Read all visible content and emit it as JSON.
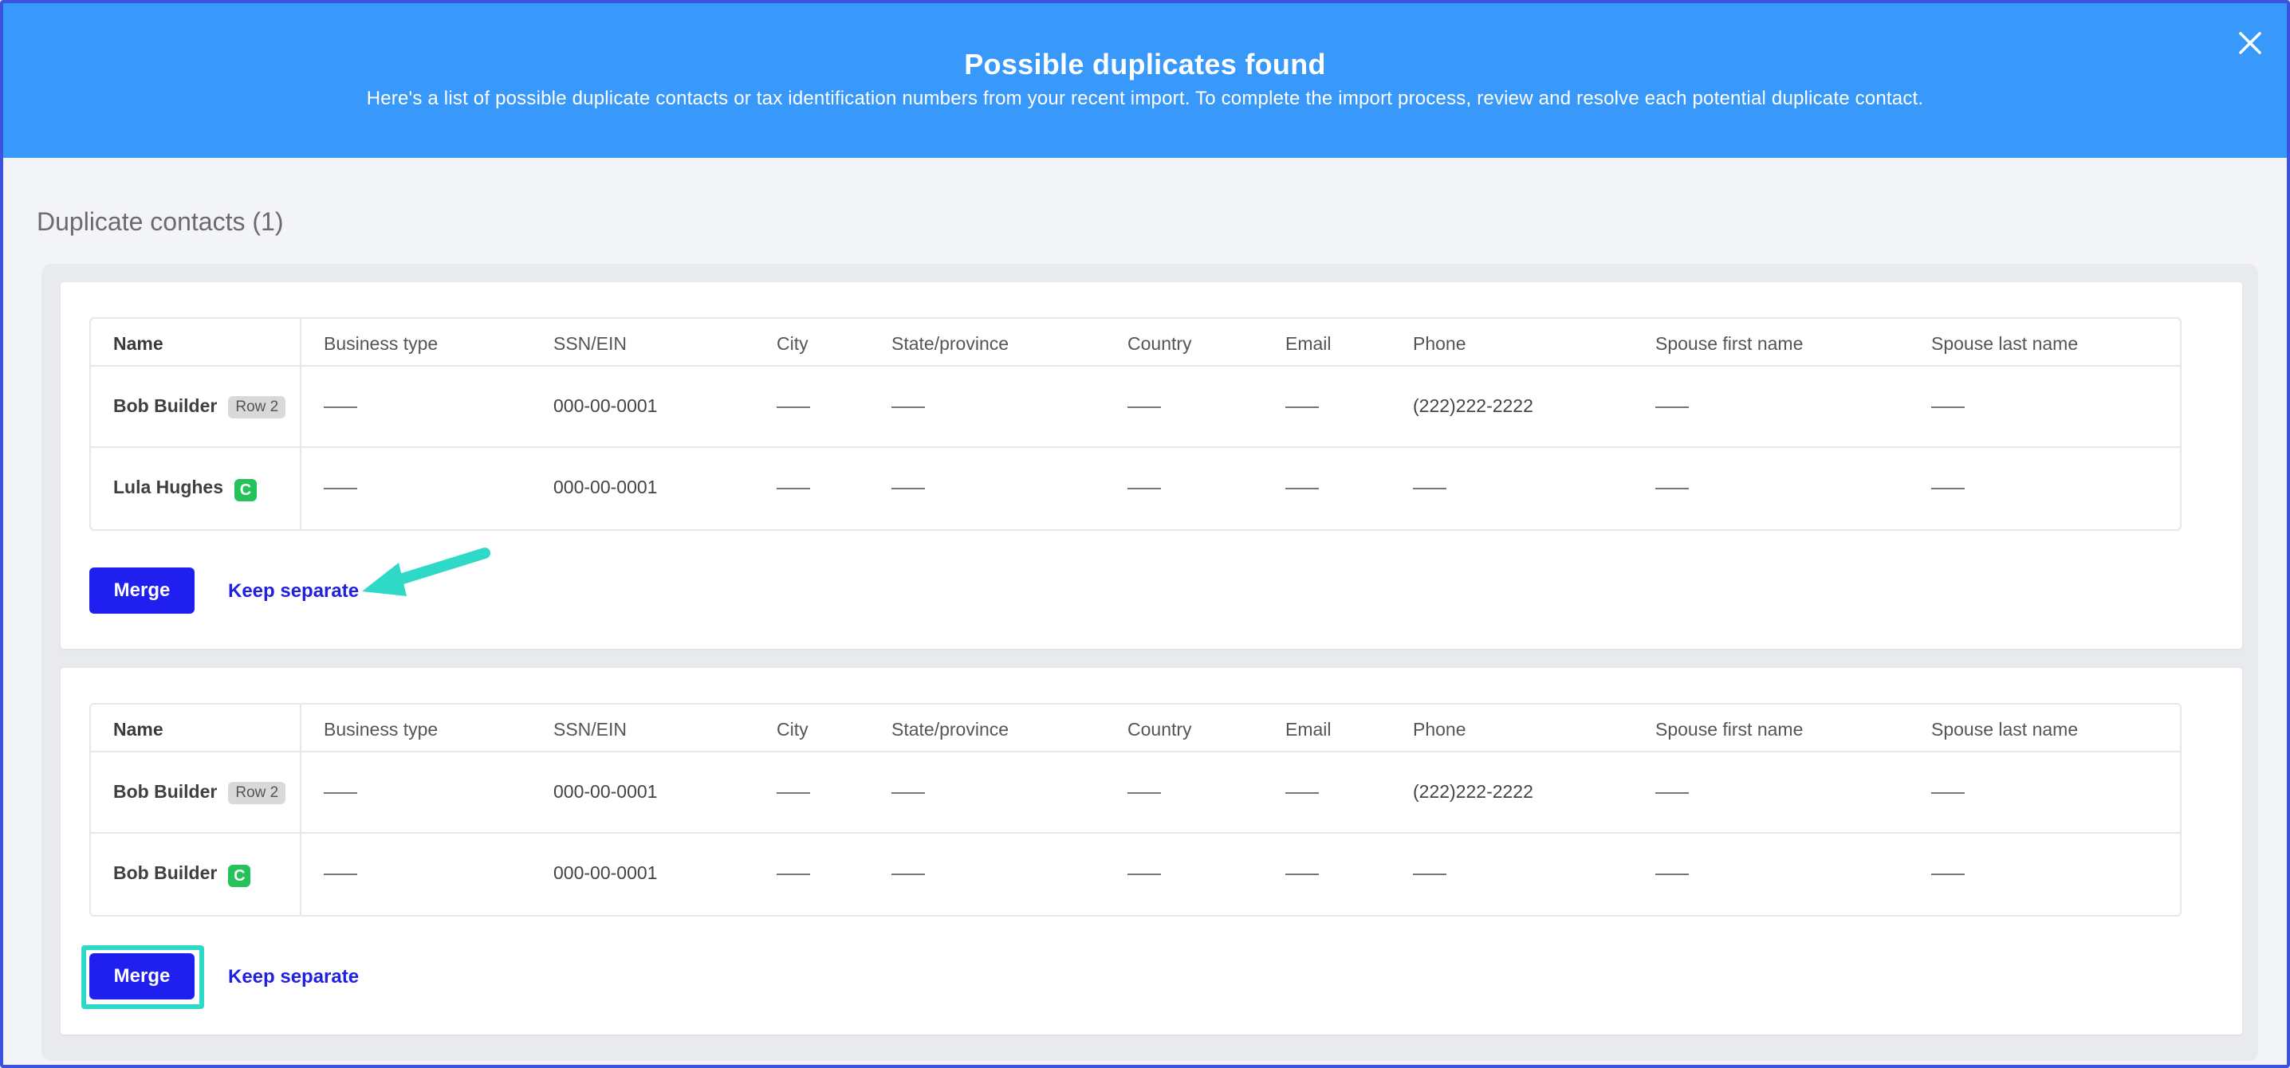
{
  "banner": {
    "title": "Possible duplicates found",
    "subtitle": "Here's a list of possible duplicate contacts or tax identification numbers from your recent import. To complete the import process, review and resolve each potential duplicate contact.",
    "close_icon": "close-icon"
  },
  "section": {
    "title": "Duplicate contacts (1)"
  },
  "columns": [
    "Name",
    "Business type",
    "SSN/EIN",
    "City",
    "State/province",
    "Country",
    "Email",
    "Phone",
    "Spouse first name",
    "Spouse last name"
  ],
  "groups": [
    {
      "rows": [
        {
          "name": "Bob Builder",
          "badge": "Row 2",
          "badge_type": "row",
          "ssn": "000-00-0001",
          "phone": "(222)222-2222"
        },
        {
          "name": "Lula Hughes",
          "badge": "C",
          "badge_type": "contact",
          "ssn": "000-00-0001",
          "phone": ""
        }
      ],
      "merge_label": "Merge",
      "keep_label": "Keep separate"
    },
    {
      "rows": [
        {
          "name": "Bob Builder",
          "badge": "Row 2",
          "badge_type": "row",
          "ssn": "000-00-0001",
          "phone": "(222)222-2222"
        },
        {
          "name": "Bob Builder",
          "badge": "C",
          "badge_type": "contact",
          "ssn": "000-00-0001",
          "phone": ""
        }
      ],
      "merge_label": "Merge",
      "keep_label": "Keep separate"
    }
  ],
  "colors": {
    "banner": "#3899fb",
    "merge_button": "#1f20f0",
    "link": "#1f20e0",
    "contact_badge": "#25c25a",
    "annotation": "#2fd9c7"
  }
}
